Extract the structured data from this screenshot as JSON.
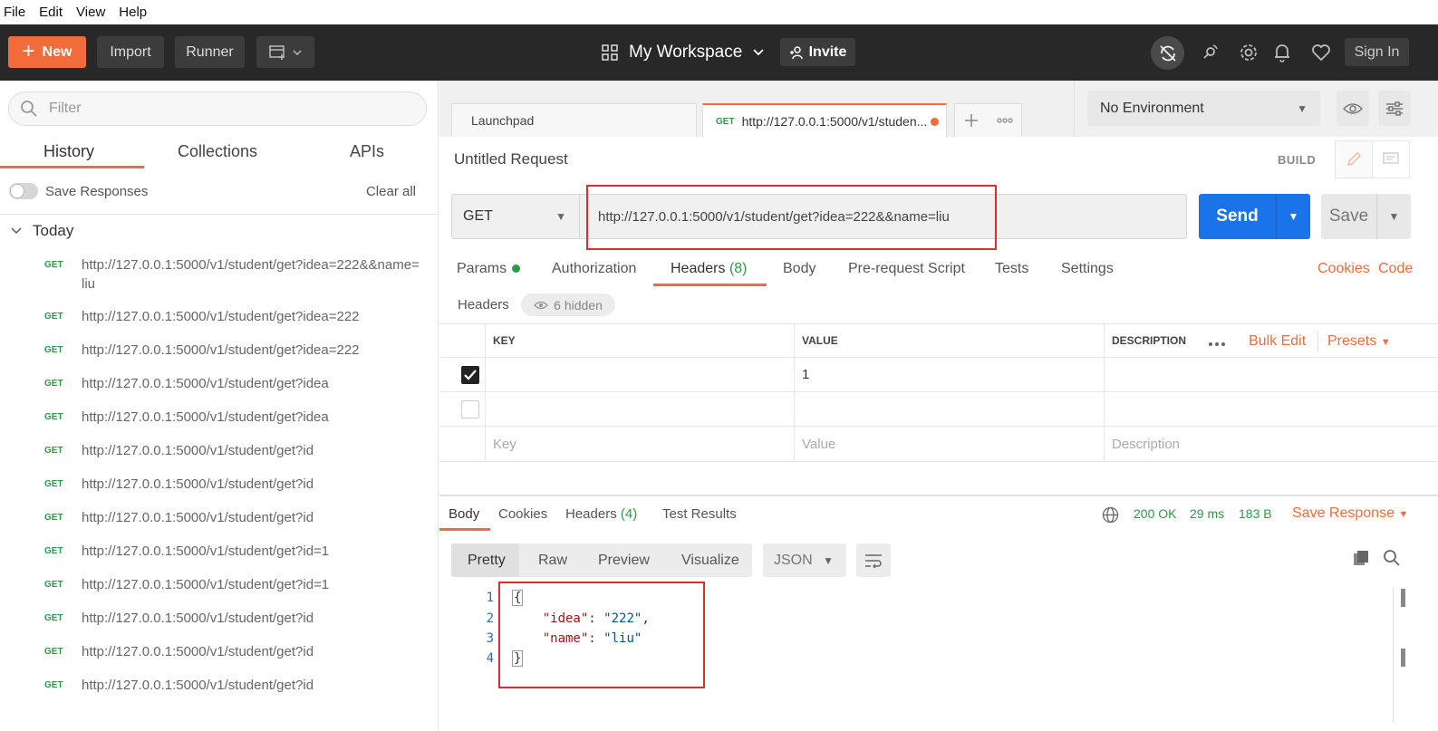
{
  "menu": [
    "File",
    "Edit",
    "View",
    "Help"
  ],
  "header": {
    "new_label": "New",
    "import_label": "Import",
    "runner_label": "Runner",
    "workspace_label": "My Workspace",
    "invite_label": "Invite",
    "signin_label": "Sign In"
  },
  "sidebar": {
    "filter_placeholder": "Filter",
    "tabs": [
      "History",
      "Collections",
      "APIs"
    ],
    "save_responses_label": "Save Responses",
    "clear_all_label": "Clear all",
    "group_label": "Today",
    "history": [
      {
        "method": "GET",
        "url": "http://127.0.0.1:5000/v1/student/get?idea=222&&name=liu"
      },
      {
        "method": "GET",
        "url": "http://127.0.0.1:5000/v1/student/get?idea=222"
      },
      {
        "method": "GET",
        "url": "http://127.0.0.1:5000/v1/student/get?idea=222"
      },
      {
        "method": "GET",
        "url": "http://127.0.0.1:5000/v1/student/get?idea"
      },
      {
        "method": "GET",
        "url": "http://127.0.0.1:5000/v1/student/get?idea"
      },
      {
        "method": "GET",
        "url": "http://127.0.0.1:5000/v1/student/get?id"
      },
      {
        "method": "GET",
        "url": "http://127.0.0.1:5000/v1/student/get?id"
      },
      {
        "method": "GET",
        "url": "http://127.0.0.1:5000/v1/student/get?id"
      },
      {
        "method": "GET",
        "url": "http://127.0.0.1:5000/v1/student/get?id=1"
      },
      {
        "method": "GET",
        "url": "http://127.0.0.1:5000/v1/student/get?id=1"
      },
      {
        "method": "GET",
        "url": "http://127.0.0.1:5000/v1/student/get?id"
      },
      {
        "method": "GET",
        "url": "http://127.0.0.1:5000/v1/student/get?id"
      },
      {
        "method": "GET",
        "url": "http://127.0.0.1:5000/v1/student/get?id"
      }
    ]
  },
  "tabs": {
    "launchpad_label": "Launchpad",
    "active_method": "GET",
    "active_title": "http://127.0.0.1:5000/v1/studen..."
  },
  "environment": {
    "selected": "No Environment"
  },
  "request": {
    "name": "Untitled Request",
    "build_label": "BUILD",
    "method": "GET",
    "url": "http://127.0.0.1:5000/v1/student/get?idea=222&&name=liu",
    "send_label": "Send",
    "save_label": "Save",
    "tabs": {
      "params": "Params",
      "authorization": "Authorization",
      "headers": "Headers",
      "headers_count": "(8)",
      "body": "Body",
      "prerequest": "Pre-request Script",
      "tests": "Tests",
      "settings": "Settings",
      "cookies": "Cookies",
      "code": "Code"
    },
    "headers_label": "Headers",
    "hidden_label": "6 hidden",
    "table": {
      "col_key": "KEY",
      "col_value": "VALUE",
      "col_description": "DESCRIPTION",
      "bulk_edit": "Bulk Edit",
      "presets": "Presets",
      "row1_value": "1",
      "placeholder_key": "Key",
      "placeholder_value": "Value",
      "placeholder_description": "Description"
    }
  },
  "response": {
    "tabs": {
      "body": "Body",
      "cookies": "Cookies",
      "headers": "Headers",
      "headers_count": "(4)",
      "test_results": "Test Results"
    },
    "status": "200 OK",
    "time": "29 ms",
    "size": "183 B",
    "save_response_label": "Save Response",
    "format_tabs": [
      "Pretty",
      "Raw",
      "Preview",
      "Visualize"
    ],
    "format_select": "JSON",
    "code_lines": [
      "1",
      "2",
      "3",
      "4"
    ],
    "json": {
      "open": "{",
      "k1": "\"idea\"",
      "v1": "\"222\"",
      "k2": "\"name\"",
      "v2": "\"liu\"",
      "close": "}"
    }
  },
  "colors": {
    "accent": "#f26b3a",
    "send": "#1a73e8",
    "method_get": "#2a9c46",
    "header_bg": "#282828",
    "highlight": "#e32b2b"
  }
}
